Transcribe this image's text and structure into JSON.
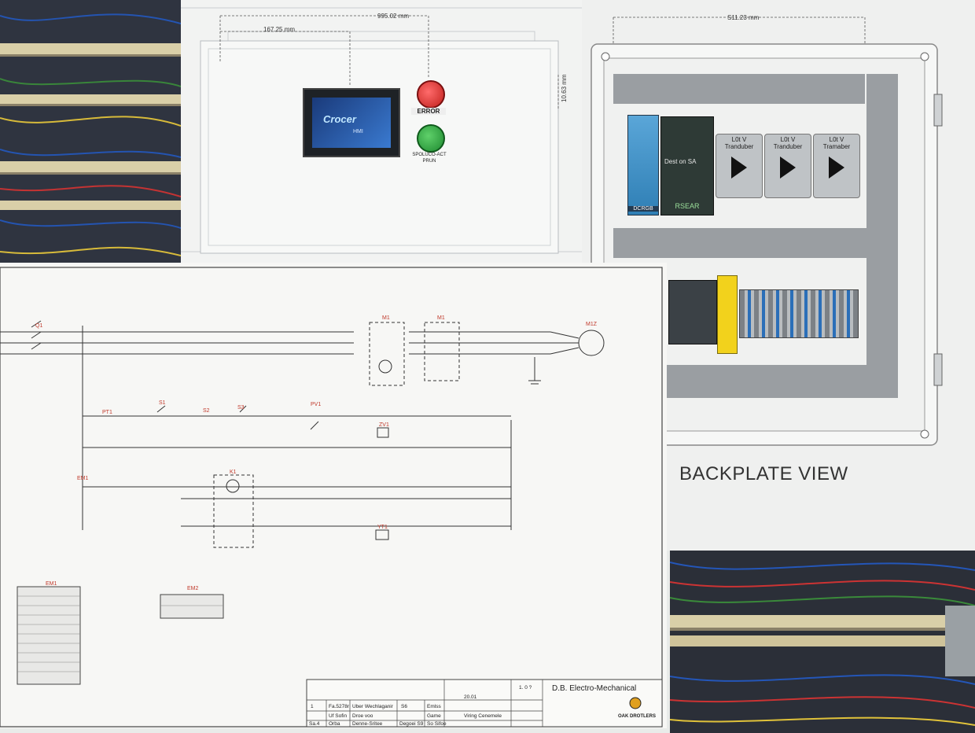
{
  "front_view": {
    "dim_total": "995.02 mm",
    "dim_left": "167.25 mm",
    "dim_right": "10.63 mm",
    "hmi_brand": "Crocer",
    "hmi_sub": "HMI",
    "error_label": "ERROR",
    "run_label_line1": "SPOLUCO-ACT",
    "run_label_line2": "PRUN"
  },
  "backplate": {
    "dim_top": "S11.23 mm",
    "title": "BACKPLATE VIEW",
    "psu1_label": "DCRGB",
    "psu2_brand": "Dest on SA",
    "psu2_label": "RSEAR",
    "transducers": [
      {
        "line1": "L0t V",
        "line2": "Tranduber"
      },
      {
        "line1": "L0t V",
        "line2": "Tranduber"
      },
      {
        "line1": "L0t V",
        "line2": "Tramaber"
      }
    ]
  },
  "schematic": {
    "motor_label": "M1Z",
    "refs": [
      "Q1",
      "M1",
      "M1",
      "S1",
      "S2",
      "PT1",
      "S3",
      "PV1",
      "ZV1",
      "K1",
      "YT1",
      "EM1"
    ],
    "connectors": [
      "EM1",
      "EM2"
    ],
    "title_block": {
      "company": "D.B. Electro-Mechanical",
      "project": "Viring Cenemele",
      "logo_text": "OAK DROTLERS",
      "rev_rows": [
        [
          "1",
          "Fa.5278r",
          "Uber Wechlaganir",
          "S6",
          "Emlss"
        ],
        [
          "",
          "Uf Sofin",
          "Droe voo",
          "",
          "Game"
        ],
        [
          "Sa.4",
          "Orba",
          "Denne-Sritee",
          "Degoei S9",
          "So Sifoe"
        ]
      ],
      "date": "20.01",
      "sheet": "1. 0 ?"
    }
  }
}
